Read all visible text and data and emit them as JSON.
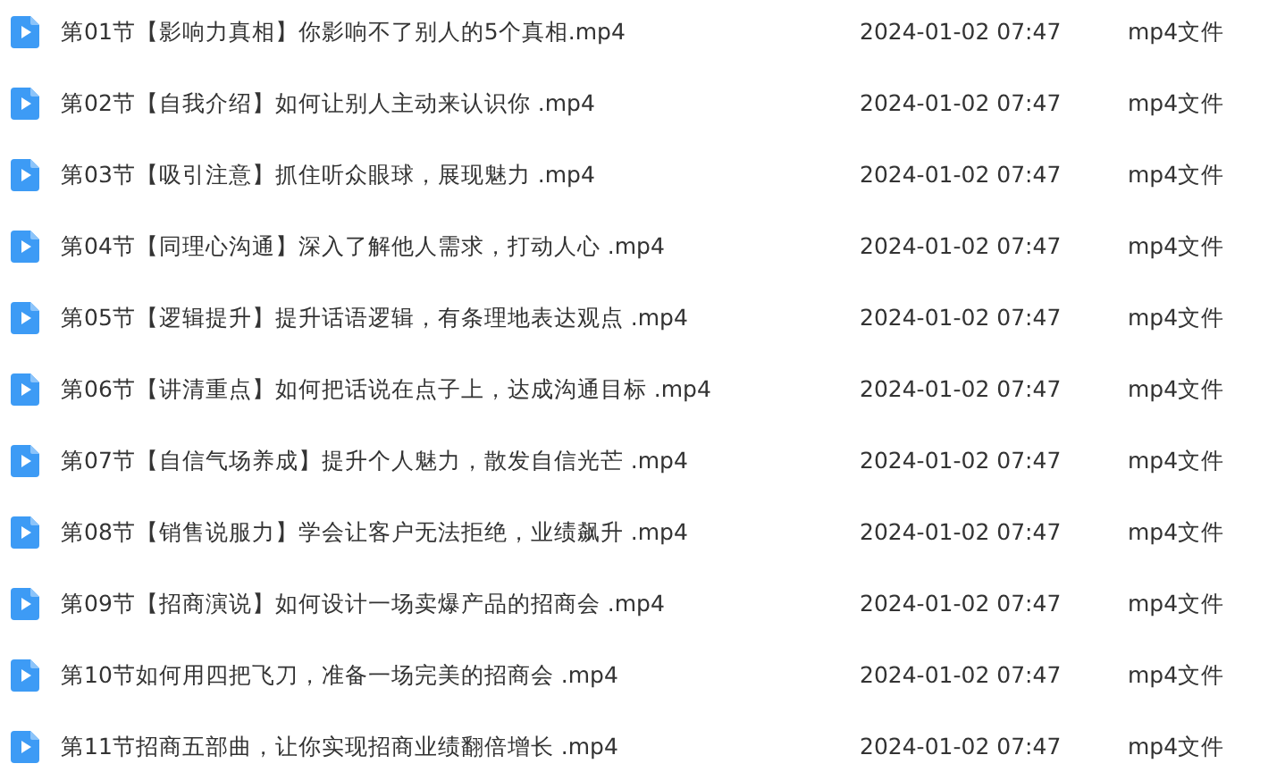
{
  "files": [
    {
      "name": "第01节【影响力真相】你影响不了别人的5个真相.mp4",
      "modified": "2024-01-02 07:47",
      "type": "mp4文件"
    },
    {
      "name": "第02节【自我介绍】如何让别人主动来认识你 .mp4",
      "modified": "2024-01-02 07:47",
      "type": "mp4文件"
    },
    {
      "name": "第03节【吸引注意】抓住听众眼球，展现魅力 .mp4",
      "modified": "2024-01-02 07:47",
      "type": "mp4文件"
    },
    {
      "name": "第04节【同理心沟通】深入了解他人需求，打动人心 .mp4",
      "modified": "2024-01-02 07:47",
      "type": "mp4文件"
    },
    {
      "name": "第05节【逻辑提升】提升话语逻辑，有条理地表达观点 .mp4",
      "modified": "2024-01-02 07:47",
      "type": "mp4文件"
    },
    {
      "name": "第06节【讲清重点】如何把话说在点子上，达成沟通目标 .mp4",
      "modified": "2024-01-02 07:47",
      "type": "mp4文件"
    },
    {
      "name": "第07节【自信气场养成】提升个人魅力，散发自信光芒 .mp4",
      "modified": "2024-01-02 07:47",
      "type": "mp4文件"
    },
    {
      "name": "第08节【销售说服力】学会让客户无法拒绝，业绩飙升 .mp4",
      "modified": "2024-01-02 07:47",
      "type": "mp4文件"
    },
    {
      "name": "第09节【招商演说】如何设计一场卖爆产品的招商会 .mp4",
      "modified": "2024-01-02 07:47",
      "type": "mp4文件"
    },
    {
      "name": "第10节如何用四把飞刀，准备一场完美的招商会 .mp4",
      "modified": "2024-01-02 07:47",
      "type": "mp4文件"
    },
    {
      "name": "第11节招商五部曲，让你实现招商业绩翻倍增长 .mp4",
      "modified": "2024-01-02 07:47",
      "type": "mp4文件"
    }
  ]
}
